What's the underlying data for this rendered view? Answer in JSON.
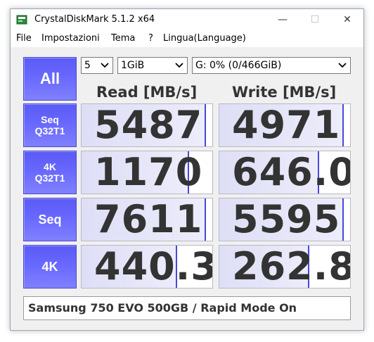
{
  "window": {
    "title": "CrystalDiskMark 5.1.2 x64",
    "minimize": "—",
    "maximize": "☐",
    "close": "✕"
  },
  "menu": [
    "File",
    "Impostazioni",
    "Tema",
    "?",
    "Lingua(Language)"
  ],
  "controls": {
    "all_label": "All",
    "count": "5",
    "size": "1GiB",
    "drive": "G: 0% (0/466GiB)"
  },
  "headers": {
    "read": "Read [MB/s]",
    "write": "Write [MB/s]"
  },
  "rows": [
    {
      "label_line1": "Seq",
      "label_line2": "Q32T1",
      "read": "5487",
      "write": "4971",
      "read_fill": 0.94,
      "write_fill": 0.94
    },
    {
      "label_line1": "4K",
      "label_line2": "Q32T1",
      "read": "1170",
      "write": "646.0",
      "read_fill": 0.81,
      "write_fill": 0.75
    },
    {
      "label_line1": "Seq",
      "label_line2": "",
      "read": "7611",
      "write": "5595",
      "read_fill": 0.94,
      "write_fill": 0.94
    },
    {
      "label_line1": "4K",
      "label_line2": "",
      "read": "440.3",
      "write": "262.8",
      "read_fill": 0.72,
      "write_fill": 0.68
    }
  ],
  "comment": "Samsung 750 EVO 500GB / Rapid Mode On",
  "colors": {
    "button_blue": "#6868ff",
    "bar_border": "#4848d8"
  },
  "icons": {
    "app": "crystaldiskmark-app-icon",
    "dropdown": "chevron-down-icon"
  }
}
